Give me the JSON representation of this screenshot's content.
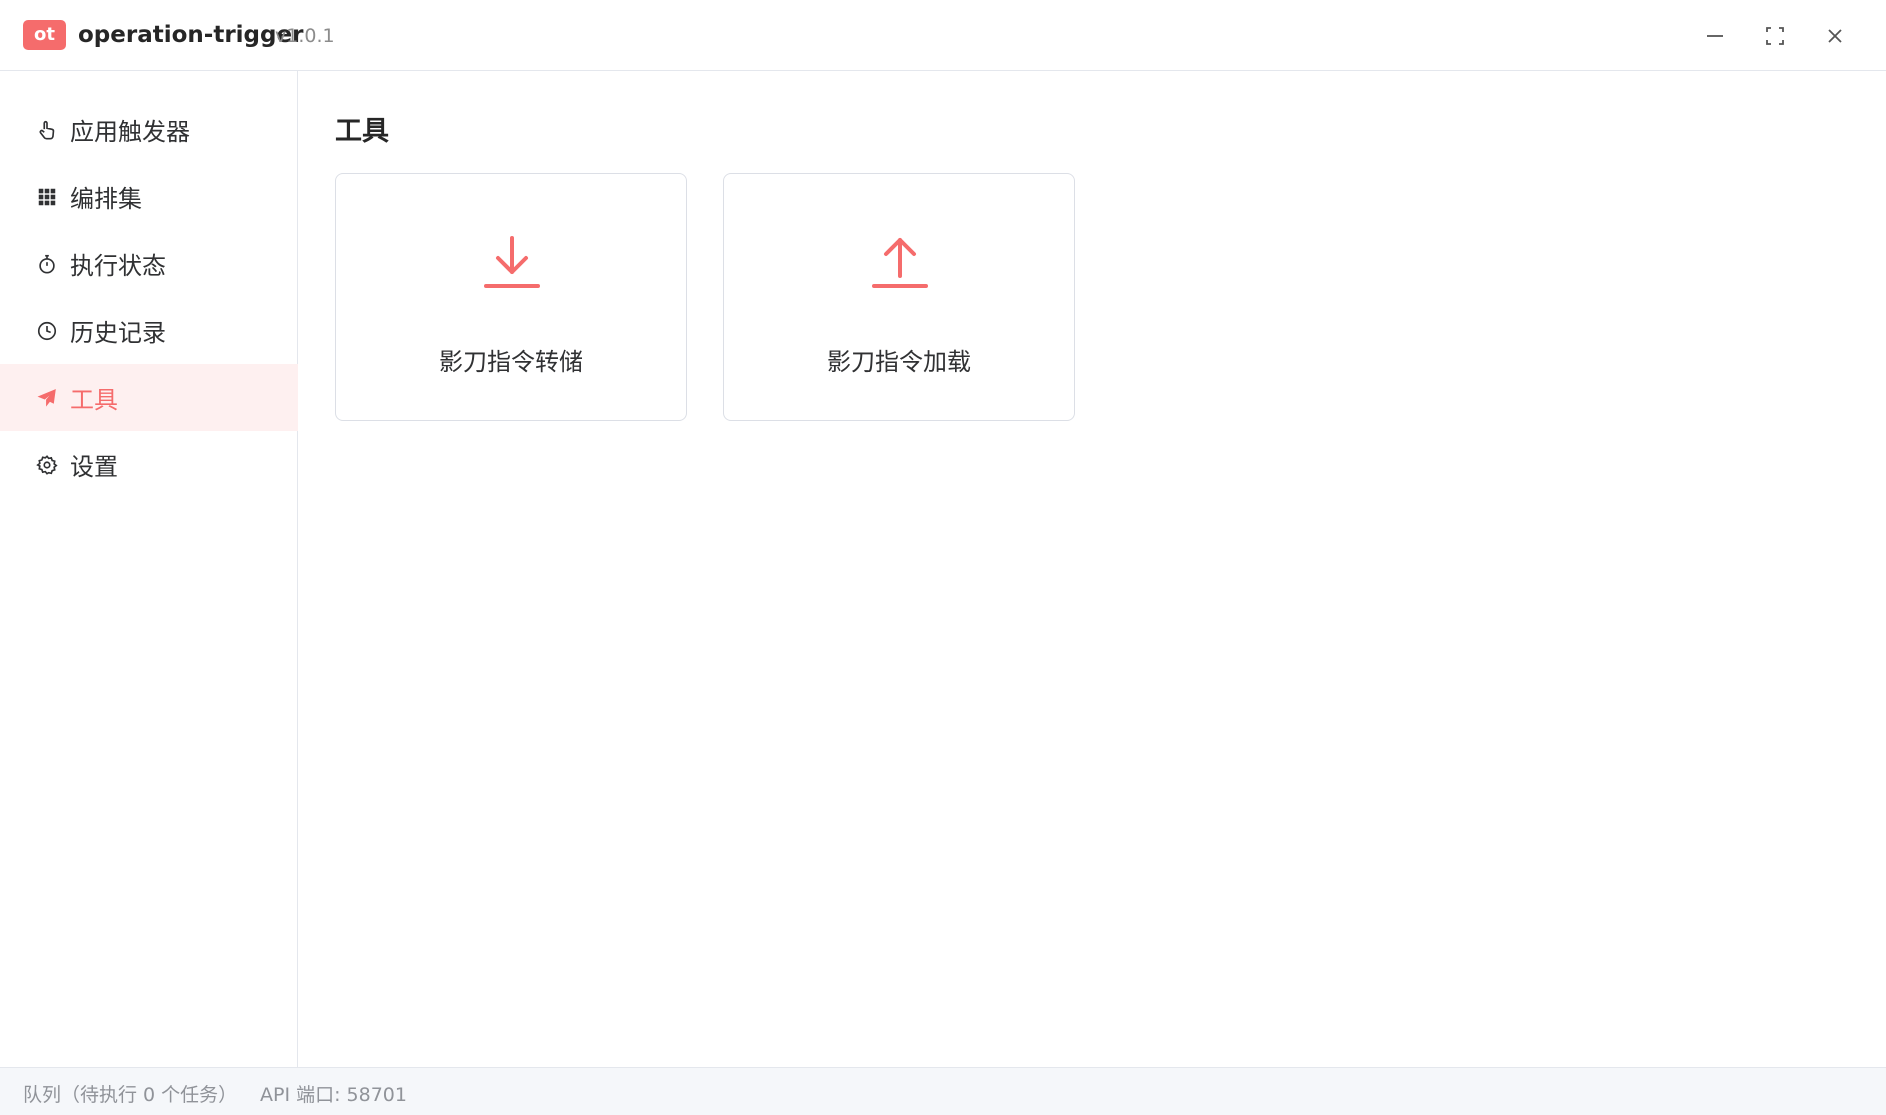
{
  "app": {
    "logo_text": "ot",
    "name": "operation-trigger",
    "version": "v1.0.1"
  },
  "sidebar": {
    "items": [
      {
        "label": "应用触发器",
        "icon": "pointer-hand-icon"
      },
      {
        "label": "编排集",
        "icon": "grid-icon"
      },
      {
        "label": "执行状态",
        "icon": "stopwatch-icon"
      },
      {
        "label": "历史记录",
        "icon": "clock-icon"
      },
      {
        "label": "工具",
        "icon": "paper-plane-icon",
        "active": true
      },
      {
        "label": "设置",
        "icon": "gear-icon"
      }
    ]
  },
  "main": {
    "title": "工具",
    "tools": [
      {
        "label": "影刀指令转储",
        "icon": "download-icon"
      },
      {
        "label": "影刀指令加载",
        "icon": "upload-icon"
      }
    ]
  },
  "status": {
    "queue": "队列（待执行 0 个任务）",
    "port": "API 端口: 58701"
  },
  "colors": {
    "accent": "#f56c6c",
    "active_bg": "#fef0f0"
  }
}
